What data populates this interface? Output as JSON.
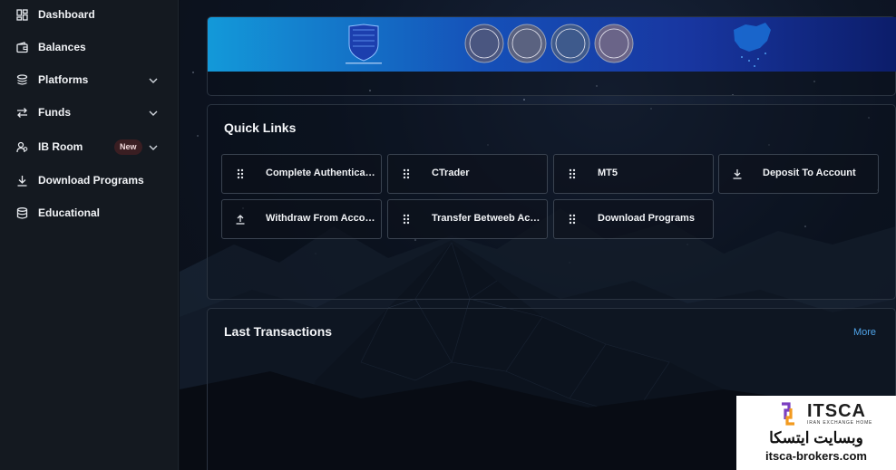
{
  "sidebar": {
    "items": [
      {
        "label": "Dashboard",
        "icon": "dashboard-icon",
        "chevron": false
      },
      {
        "label": "Balances",
        "icon": "wallet-icon",
        "chevron": false
      },
      {
        "label": "Platforms",
        "icon": "layers-icon",
        "chevron": true
      },
      {
        "label": "Funds",
        "icon": "transfer-arrows-icon",
        "chevron": true
      },
      {
        "label": "IB Room",
        "icon": "users-icon",
        "chevron": true,
        "badge": "New"
      },
      {
        "label": "Download Programs",
        "icon": "download-icon",
        "chevron": false
      },
      {
        "label": "Educational",
        "icon": "database-icon",
        "chevron": false
      }
    ]
  },
  "quick_links": {
    "title": "Quick Links",
    "buttons": [
      {
        "label": "Complete Authenticati...",
        "icon": "grip-dots-icon"
      },
      {
        "label": "CTrader",
        "icon": "grip-dots-icon"
      },
      {
        "label": "MT5",
        "icon": "grip-dots-icon"
      },
      {
        "label": "Deposit To Account",
        "icon": "download-icon"
      },
      {
        "label": "Withdraw From Account",
        "icon": "upload-icon"
      },
      {
        "label": "Transfer Betweeb Acc...",
        "icon": "grip-dots-icon"
      },
      {
        "label": "Download Programs",
        "icon": "grip-dots-icon"
      }
    ]
  },
  "transactions": {
    "title": "Last Transactions",
    "more_label": "More"
  },
  "watermark": {
    "brand": "ITSCA",
    "subtitle": "IRAN EXCHANGE HOME",
    "persian": "وبسایت ایتسکا",
    "url": "itsca-brokers.com"
  },
  "colors": {
    "sidebar_bg": "#141920",
    "accent_link": "#4fa3e8",
    "badge_bg": "#3a1e22",
    "banner_start": "#1399d9",
    "banner_end": "#0c1d6a"
  }
}
